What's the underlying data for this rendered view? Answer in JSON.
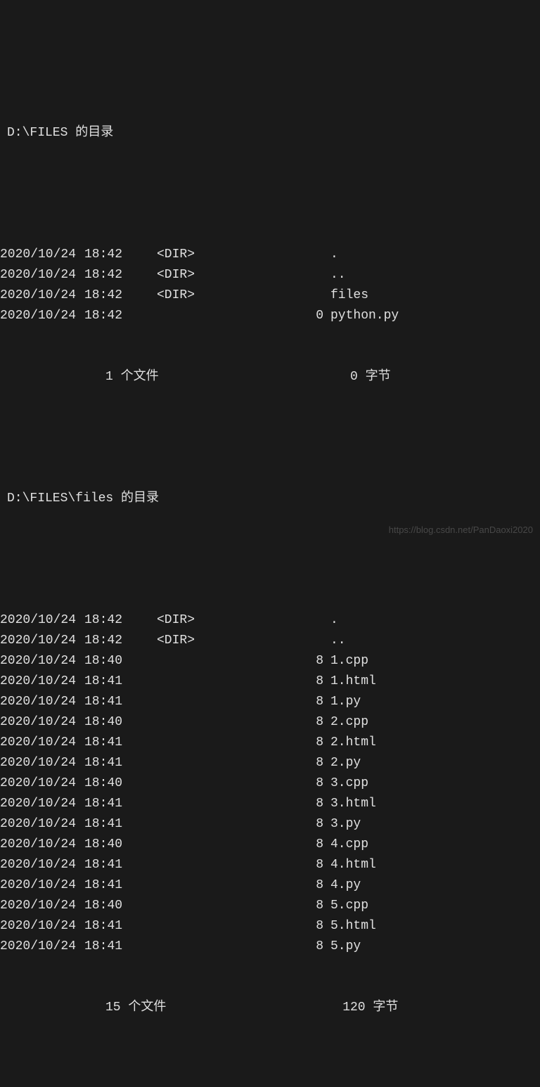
{
  "section1": {
    "header": "D:\\FILES 的目录",
    "rows": [
      {
        "date": "2020/10/24",
        "time": "18:42",
        "dir": "<DIR>",
        "size": "",
        "name": "."
      },
      {
        "date": "2020/10/24",
        "time": "18:42",
        "dir": "<DIR>",
        "size": "",
        "name": ".."
      },
      {
        "date": "2020/10/24",
        "time": "18:42",
        "dir": "<DIR>",
        "size": "",
        "name": "files"
      },
      {
        "date": "2020/10/24",
        "time": "18:42",
        "dir": "",
        "size": "0",
        "name": "python.py"
      }
    ],
    "summary_files": "1 个文件",
    "summary_bytes": "0 字节"
  },
  "section2": {
    "header": "D:\\FILES\\files 的目录",
    "rows": [
      {
        "date": "2020/10/24",
        "time": "18:42",
        "dir": "<DIR>",
        "size": "",
        "name": "."
      },
      {
        "date": "2020/10/24",
        "time": "18:42",
        "dir": "<DIR>",
        "size": "",
        "name": ".."
      },
      {
        "date": "2020/10/24",
        "time": "18:40",
        "dir": "",
        "size": "8",
        "name": "1.cpp"
      },
      {
        "date": "2020/10/24",
        "time": "18:41",
        "dir": "",
        "size": "8",
        "name": "1.html"
      },
      {
        "date": "2020/10/24",
        "time": "18:41",
        "dir": "",
        "size": "8",
        "name": "1.py"
      },
      {
        "date": "2020/10/24",
        "time": "18:40",
        "dir": "",
        "size": "8",
        "name": "2.cpp"
      },
      {
        "date": "2020/10/24",
        "time": "18:41",
        "dir": "",
        "size": "8",
        "name": "2.html"
      },
      {
        "date": "2020/10/24",
        "time": "18:41",
        "dir": "",
        "size": "8",
        "name": "2.py"
      },
      {
        "date": "2020/10/24",
        "time": "18:40",
        "dir": "",
        "size": "8",
        "name": "3.cpp"
      },
      {
        "date": "2020/10/24",
        "time": "18:41",
        "dir": "",
        "size": "8",
        "name": "3.html"
      },
      {
        "date": "2020/10/24",
        "time": "18:41",
        "dir": "",
        "size": "8",
        "name": "3.py"
      },
      {
        "date": "2020/10/24",
        "time": "18:40",
        "dir": "",
        "size": "8",
        "name": "4.cpp"
      },
      {
        "date": "2020/10/24",
        "time": "18:41",
        "dir": "",
        "size": "8",
        "name": "4.html"
      },
      {
        "date": "2020/10/24",
        "time": "18:41",
        "dir": "",
        "size": "8",
        "name": "4.py"
      },
      {
        "date": "2020/10/24",
        "time": "18:40",
        "dir": "",
        "size": "8",
        "name": "5.cpp"
      },
      {
        "date": "2020/10/24",
        "time": "18:41",
        "dir": "",
        "size": "8",
        "name": "5.html"
      },
      {
        "date": "2020/10/24",
        "time": "18:41",
        "dir": "",
        "size": "8",
        "name": "5.py"
      }
    ],
    "summary_files": "15 个文件",
    "summary_bytes": "120 字节"
  },
  "watermark": "https://blog.csdn.net/PanDaoxi2020"
}
